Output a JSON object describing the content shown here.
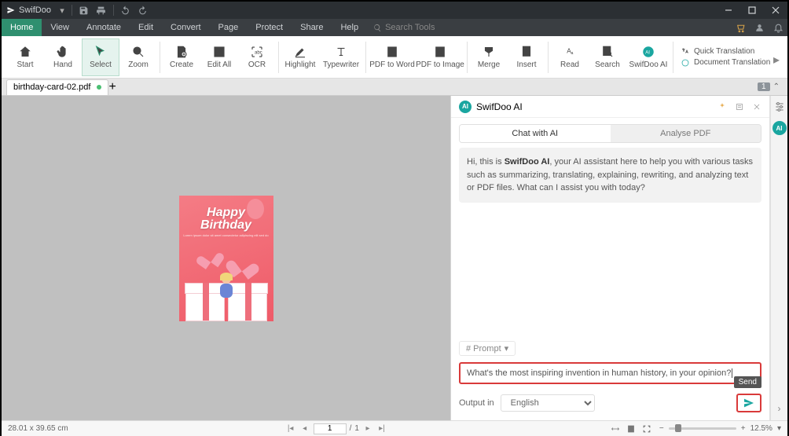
{
  "title_app": "SwifDoo",
  "menu": {
    "items": [
      "Home",
      "View",
      "Annotate",
      "Edit",
      "Convert",
      "Page",
      "Protect",
      "Share",
      "Help"
    ],
    "search": "Search Tools"
  },
  "ribbon": {
    "items": [
      {
        "id": "start",
        "lbl": "Start"
      },
      {
        "id": "hand",
        "lbl": "Hand"
      },
      {
        "id": "select",
        "lbl": "Select"
      },
      {
        "id": "zoom",
        "lbl": "Zoom"
      },
      {
        "id": "create",
        "lbl": "Create"
      },
      {
        "id": "editall",
        "lbl": "Edit All"
      },
      {
        "id": "ocr",
        "lbl": "OCR"
      },
      {
        "id": "highlight",
        "lbl": "Highlight"
      },
      {
        "id": "typewriter",
        "lbl": "Typewriter"
      },
      {
        "id": "pdfword",
        "lbl": "PDF to Word"
      },
      {
        "id": "pdfimage",
        "lbl": "PDF to Image"
      },
      {
        "id": "merge",
        "lbl": "Merge"
      },
      {
        "id": "insert",
        "lbl": "Insert"
      },
      {
        "id": "read",
        "lbl": "Read"
      },
      {
        "id": "search",
        "lbl": "Search"
      },
      {
        "id": "swai",
        "lbl": "SwifDoo AI"
      }
    ],
    "quick_trans": "Quick Translation",
    "doc_trans": "Document Translation"
  },
  "doctab": {
    "filename": "birthday-card-02.pdf",
    "badge": "1"
  },
  "card": {
    "title": "Happy",
    "title2": "Birthday",
    "subtitle": "Lorem ipsum dolor sit amet consectetur adipiscing elit sed do"
  },
  "ai": {
    "panel_title": "SwifDoo AI",
    "tab_chat": "Chat with AI",
    "tab_analyse": "Analyse PDF",
    "greet_pre": "Hi, this is ",
    "greet_bold": "SwifDoo AI",
    "greet_post": ", your AI assistant here to help you with various tasks such as summarizing, translating, explaining, rewriting, and analyzing text or PDF files. What can I assist you with today?",
    "prompt_label": "# Prompt",
    "input_text": "What's the most inspiring invention in human history, in your opinion?",
    "output_in": "Output in",
    "language": "English",
    "send": "Send"
  },
  "status": {
    "dim": "28.01 x 39.65 cm",
    "page": "1",
    "total": "1",
    "zoom": "12.5%"
  }
}
